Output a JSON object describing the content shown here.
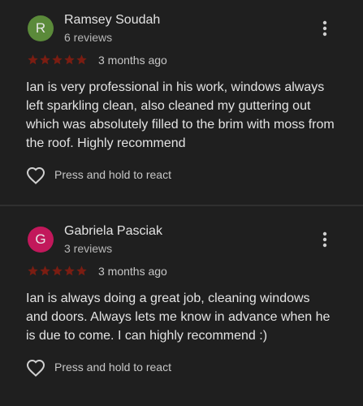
{
  "reviews": [
    {
      "avatar_letter": "R",
      "avatar_color": "#5b8a3a",
      "author": "Ramsey Soudah",
      "review_count": "6 reviews",
      "rating": 5,
      "date": "3 months ago",
      "text": "Ian is very professional in his work, windows always left sparkling clean, also cleaned my guttering out which was absolutely filled to the brim with moss from the roof. Highly recommend",
      "react_label": "Press and hold to react"
    },
    {
      "avatar_letter": "G",
      "avatar_color": "#c2185b",
      "author": "Gabriela Pasciak",
      "review_count": "3 reviews",
      "rating": 5,
      "date": "3 months ago",
      "text": "Ian is always doing a great job, cleaning windows and doors. Always lets me know in advance when he is due to come. I can highly recommend :)",
      "react_label": "Press and hold to react"
    }
  ],
  "icons": {
    "menu": "more-vert-icon",
    "react": "heart-outline-icon",
    "star": "star-icon"
  },
  "colors": {
    "background": "#1f1f1f",
    "star": "#7a1d12"
  }
}
